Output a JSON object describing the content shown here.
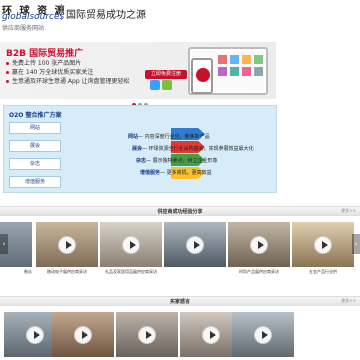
{
  "header": {
    "logo_cn": "环 球 资 源",
    "logo_en": "globalsources",
    "slogan": "国际贸易成功之源",
    "subnav": "供应商服务网站"
  },
  "banner": {
    "title": "B2B 国际贸易推广",
    "bullets": [
      "免费上传 100 张产品图片",
      "赢在 140 万全球优质买家关注",
      "生意通及环球生意通 App 让询盘管理更轻松"
    ],
    "cta_label": "立即免费注册",
    "phone_logo_text": ""
  },
  "o2o": {
    "title": "O2O 整合推广方案",
    "menu": [
      "网站",
      "展会",
      "杂志",
      "增值服务"
    ],
    "lines": [
      {
        "label": "网站",
        "text": "— 内容深度行业化，聚焦新产品"
      },
      {
        "label": "展会",
        "text": "— 环球资源全行业采购盛会，实现参展效益最大化"
      },
      {
        "label": "杂志",
        "text": "— 展示独特卖点，树立企业形象"
      },
      {
        "label": "增值服务",
        "text": "— 更多商机，更高效益"
      }
    ]
  },
  "section1": {
    "title": "供应商成功经验分享",
    "more": "更多>>",
    "videos": [
      {
        "caption": "制诊"
      },
      {
        "caption": "移动电子展供应商采访"
      },
      {
        "caption": "礼品及家居用品展供应商采访"
      },
      {
        "caption": ""
      },
      {
        "caption": "时尚产品展供应商采访"
      },
      {
        "caption": "五金产品行业供"
      }
    ]
  },
  "section2": {
    "title": "买家感言",
    "more": "更多>>",
    "videos": [
      {
        "caption": ""
      },
      {
        "caption": ""
      },
      {
        "caption": ""
      },
      {
        "caption": ""
      },
      {
        "caption": ""
      }
    ]
  },
  "colors": {
    "brand_red": "#c8102e",
    "brand_blue": "#1b3c8c",
    "o2o_bg": "#d6ecf8"
  },
  "icons": {
    "play": "play-icon",
    "prev": "chevron-left-icon",
    "next": "chevron-right-icon"
  }
}
